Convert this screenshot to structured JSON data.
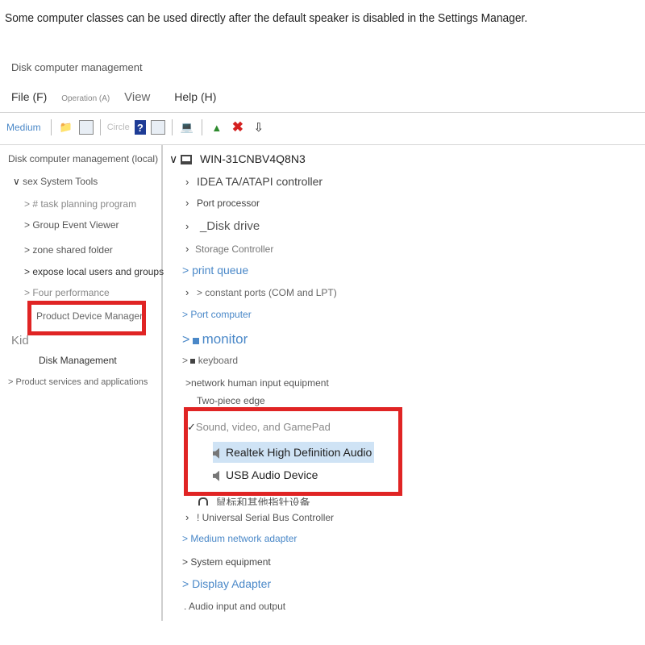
{
  "caption": "Some computer classes can be used directly after the default speaker is disabled in the Settings Manager.",
  "app_title": "Disk computer management",
  "menu": {
    "file": "File (F)",
    "operation": "Operation (A)",
    "view": "View",
    "help": "Help (H)"
  },
  "toolbar": {
    "medium_label": "Medium",
    "circle_label": "Circle"
  },
  "left_tree": {
    "root": "Disk computer management (local)",
    "system_tools": "sex System Tools",
    "task_planning": "> # task planning program",
    "event_viewer": "> Group Event Viewer",
    "shared_folder": "> zone shared folder",
    "local_users": "> expose local users and groups",
    "performance": "> Four performance",
    "device_manager": "Product Device Manager",
    "kid": "Kid",
    "disk_management": "Disk Management",
    "services": "> Product services and applications"
  },
  "right_tree": {
    "root": "WIN-31CNBV4Q8N3",
    "ide": "IDEA TA/ATAPI controller",
    "processor": "Port processor",
    "disk_drive": "_Disk drive",
    "storage": "Storage Controller",
    "print_queue": "> print queue",
    "ports": "> constant ports (COM and LPT)",
    "port_computer": "> Port computer",
    "monitor": "monitor",
    "keyboard": "keyboard",
    "hid": "network human input equipment",
    "two_piece": "Two-piece edge",
    "sound": "Sound, video, and GamePad",
    "audio1": "Realtek High Definition Audio",
    "audio2": "USB Audio Device",
    "garbled": "鼠标和其他指针设备",
    "usb": "! Universal Serial Bus Controller",
    "network": "> Medium network adapter",
    "system_equipment": "> System equipment",
    "display": "> Display Adapter",
    "audio_io": ". Audio input and output"
  }
}
